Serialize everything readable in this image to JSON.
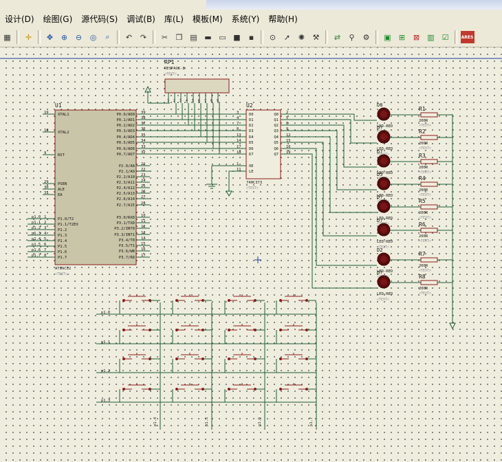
{
  "menu": [
    "设计(D)",
    "绘图(G)",
    "源代码(S)",
    "调试(B)",
    "库(L)",
    "模板(M)",
    "系统(Y)",
    "帮助(H)"
  ],
  "toolbar": {
    "icons": [
      "grid-icon",
      "origin-icon",
      "pan-icon",
      "zoom-in-icon",
      "zoom-out-icon",
      "zoom-all-icon",
      "zoom-area-icon",
      "undo-icon",
      "redo-icon",
      "cut-icon",
      "copy-icon",
      "paste-icon",
      "block-copy-icon",
      "block-move-icon",
      "block-rotate-icon",
      "block-delete-icon",
      "pick-device-icon",
      "make-device-icon",
      "packaging-icon",
      "decompose-icon",
      "wire-autoroute-icon",
      "search-icon",
      "property-assign-icon",
      "new-sheet-icon",
      "add-sheet-icon",
      "remove-sheet-icon",
      "bom-icon",
      "erc-icon",
      "ares-icon"
    ],
    "ares_label": "ARES"
  },
  "schematic": {
    "rp1": {
      "ref": "RP1",
      "value": "RESPACK-8",
      "text": "<TEXT>",
      "pins": [
        "1",
        "2",
        "3",
        "4",
        "5",
        "6",
        "7",
        "8",
        "9"
      ]
    },
    "u1": {
      "ref": "U1",
      "part": "AT89C52",
      "text": "<TEXT>",
      "left_pins": [
        {
          "num": "19",
          "name": "XTAL1"
        },
        {
          "num": "18",
          "name": "XTAL2"
        },
        {
          "num": "9",
          "name": "RST"
        },
        {
          "num": "29",
          "name": "PSEN"
        },
        {
          "num": "30",
          "name": "ALE"
        },
        {
          "num": "31",
          "name": "EA"
        },
        {
          "num": "1",
          "name": "P1.0/T2"
        },
        {
          "num": "2",
          "name": "P1.1/T2EX"
        },
        {
          "num": "3",
          "name": "P1.2"
        },
        {
          "num": "4",
          "name": "P1.3"
        },
        {
          "num": "5",
          "name": "P1.4"
        },
        {
          "num": "6",
          "name": "P1.5"
        },
        {
          "num": "7",
          "name": "P1.6"
        },
        {
          "num": "8",
          "name": "P1.7"
        }
      ],
      "right_pins": [
        {
          "num": "39",
          "name": "P0.0/AD0"
        },
        {
          "num": "38",
          "name": "P0.1/AD1"
        },
        {
          "num": "37",
          "name": "P0.2/AD2"
        },
        {
          "num": "36",
          "name": "P0.3/AD3"
        },
        {
          "num": "35",
          "name": "P0.4/AD4"
        },
        {
          "num": "34",
          "name": "P0.5/AD5"
        },
        {
          "num": "33",
          "name": "P0.6/AD6"
        },
        {
          "num": "32",
          "name": "P0.7/AD7"
        },
        {
          "num": "21",
          "name": "P2.0/A8"
        },
        {
          "num": "22",
          "name": "P2.1/A9"
        },
        {
          "num": "23",
          "name": "P2.2/A10"
        },
        {
          "num": "24",
          "name": "P2.3/A11"
        },
        {
          "num": "25",
          "name": "P2.4/A12"
        },
        {
          "num": "26",
          "name": "P2.5/A13"
        },
        {
          "num": "27",
          "name": "P2.6/A14"
        },
        {
          "num": "28",
          "name": "P2.7/A15"
        },
        {
          "num": "10",
          "name": "P3.0/RXD"
        },
        {
          "num": "11",
          "name": "P3.1/TXD"
        },
        {
          "num": "12",
          "name": "P3.2/INT0"
        },
        {
          "num": "13",
          "name": "P3.3/INT1"
        },
        {
          "num": "14",
          "name": "P3.4/T0"
        },
        {
          "num": "15",
          "name": "P3.5/T1"
        },
        {
          "num": "16",
          "name": "P3.6/WR"
        },
        {
          "num": "17",
          "name": "P3.7/RD"
        }
      ],
      "p1_net_labels": [
        "p1.0",
        "p1.1",
        "p1.2",
        "p1.3",
        "p1.4",
        "p1.5",
        "p1.6",
        "p1.7"
      ]
    },
    "u2": {
      "ref": "U2",
      "part": "74HC373",
      "text": "<TEXT>",
      "inputs": [
        {
          "num": "3",
          "name": "D0"
        },
        {
          "num": "4",
          "name": "D1"
        },
        {
          "num": "7",
          "name": "D2"
        },
        {
          "num": "8",
          "name": "D3"
        },
        {
          "num": "13",
          "name": "D4"
        },
        {
          "num": "14",
          "name": "D5"
        },
        {
          "num": "17",
          "name": "D6"
        },
        {
          "num": "18",
          "name": "D7"
        }
      ],
      "outputs": [
        {
          "num": "2",
          "name": "Q0"
        },
        {
          "num": "5",
          "name": "Q1"
        },
        {
          "num": "6",
          "name": "Q2"
        },
        {
          "num": "9",
          "name": "Q3"
        },
        {
          "num": "12",
          "name": "Q4"
        },
        {
          "num": "15",
          "name": "Q5"
        },
        {
          "num": "16",
          "name": "Q6"
        },
        {
          "num": "19",
          "name": "Q7"
        }
      ],
      "controls": [
        {
          "num": "1",
          "name": "OE"
        },
        {
          "num": "11",
          "name": "LE"
        }
      ]
    },
    "leds": [
      {
        "ref": "D8",
        "value": "LED-RED"
      },
      {
        "ref": "D?",
        "value": "LED-RED"
      },
      {
        "ref": "D?",
        "value": "LED-RED"
      },
      {
        "ref": "D5",
        "value": "LED-RED"
      },
      {
        "ref": "D?",
        "value": "LED-RED"
      },
      {
        "ref": "D?",
        "value": "LED-RED"
      },
      {
        "ref": "D2",
        "value": "LED-RED"
      },
      {
        "ref": "D?",
        "value": "LED-RED"
      }
    ],
    "resistors": [
      {
        "ref": "R1",
        "value": "200R"
      },
      {
        "ref": "R2",
        "value": "200R"
      },
      {
        "ref": "R3",
        "value": "200R"
      },
      {
        "ref": "R4",
        "value": "200R"
      },
      {
        "ref": "R5",
        "value": "200R"
      },
      {
        "ref": "R6",
        "value": "200R"
      },
      {
        "ref": "R7",
        "value": "200R"
      },
      {
        "ref": "R8",
        "value": "200R"
      }
    ],
    "text_placeholder": "<TEXT>",
    "keypad": {
      "row_labels": [
        "p1.0",
        "p1.1",
        "p1.2",
        "p1.3"
      ],
      "col_labels": [
        "p1.4",
        "p1.5",
        "p1.6",
        "p1.7"
      ]
    }
  }
}
